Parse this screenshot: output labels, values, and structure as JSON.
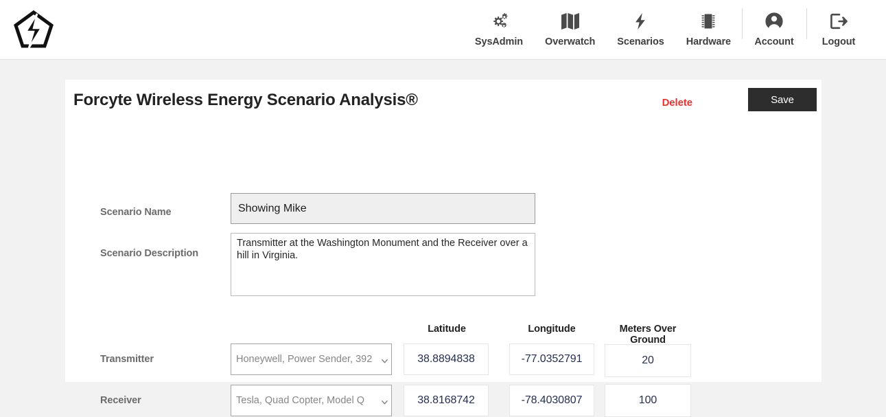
{
  "nav": {
    "logo_icon": "pentagon-bolt-logo",
    "items": [
      {
        "label": "SysAdmin",
        "icon": "gears-icon",
        "divider": false
      },
      {
        "label": "Overwatch",
        "icon": "map-icon",
        "divider": false
      },
      {
        "label": "Scenarios",
        "icon": "lightning-bolt-icon",
        "divider": false
      },
      {
        "label": "Hardware",
        "icon": "memory-chip-icon",
        "divider": false
      },
      {
        "label": "Account",
        "icon": "user-circle-icon",
        "divider": true
      },
      {
        "label": "Logout",
        "icon": "sign-out-icon",
        "divider": true
      }
    ]
  },
  "card": {
    "title": "Forcyte Wireless Energy Scenario Analysis®",
    "delete_label": "Delete",
    "save_label": "Save",
    "delete_color": "#f0302a",
    "save_bg": "#2d2d2d"
  },
  "form": {
    "scenario_name_label": "Scenario Name",
    "scenario_name_value": "Showing Mike",
    "scenario_name_placeholder": "Scenario Name",
    "scenario_description_label": "Scenario Description",
    "scenario_description_value": "Transmitter at the Washington Monument and the Receiver over a hill in Virginia.",
    "scenario_description_placeholder": "Scenario Description",
    "columns": {
      "latitude": "Latitude",
      "longitude": "Longitude",
      "meters_over_ground": "Meters Over Ground"
    },
    "rows": [
      {
        "label": "Transmitter",
        "device": "Honeywell, Power Sender, 392",
        "latitude": "38.8894838",
        "longitude": "-77.0352791",
        "meters_over_ground": "20"
      },
      {
        "label": "Receiver",
        "device": "Tesla, Quad Copter, Model Q",
        "latitude": "38.8168742",
        "longitude": "-78.4030807",
        "meters_over_ground": "100"
      }
    ],
    "value_text_color": "#252f52"
  }
}
